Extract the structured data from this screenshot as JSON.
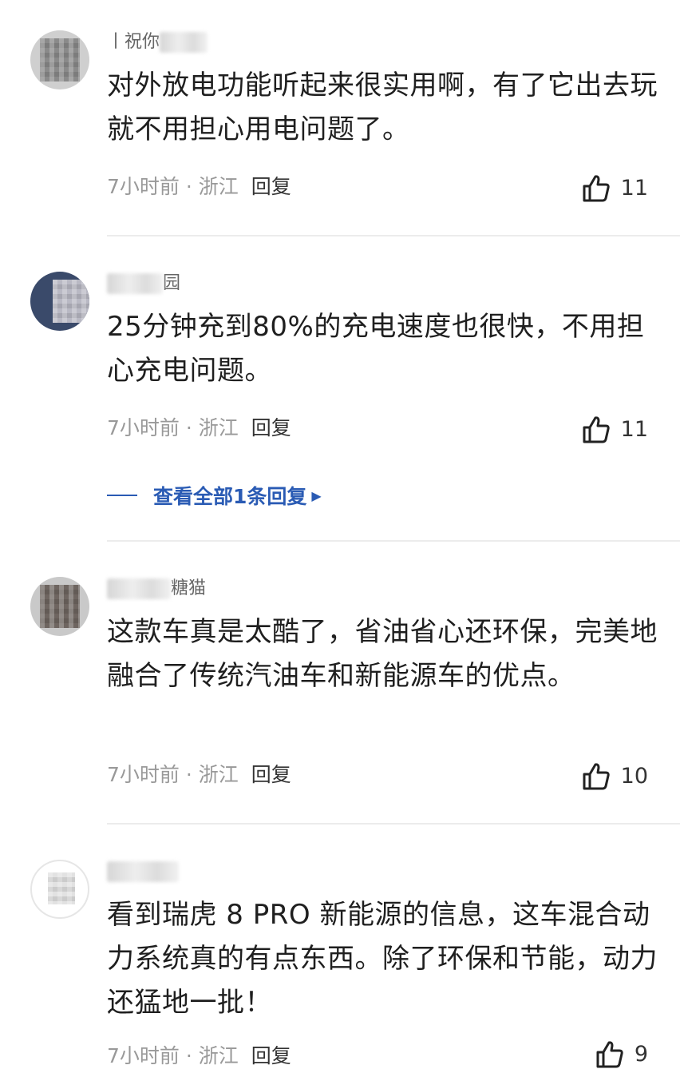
{
  "comments": [
    {
      "username": "丨祝你",
      "text": "对外放电功能听起来很实用啊，有了它出去玩就不用担心用电问题了。",
      "time": "7小时前 · 浙江",
      "reply": "回复",
      "likes": "11"
    },
    {
      "username": "园",
      "text": "25分钟充到80%的充电速度也很快，不用担心充电问题。",
      "time": "7小时前 · 浙江",
      "reply": "回复",
      "likes": "11",
      "view_all_replies": "查看全部1条回复"
    },
    {
      "username": "糖猫",
      "text": "这款车真是太酷了，省油省心还环保，完美地融合了传统汽油车和新能源车的优点。",
      "time": "7小时前 · 浙江",
      "reply": "回复",
      "likes": "10"
    },
    {
      "username": "",
      "text": "看到瑞虎 8 PRO 新能源的信息，这车混合动力系统真的有点东西。除了环保和节能，动力还猛地一批！",
      "time": "7小时前 · 浙江",
      "reply": "回复",
      "likes": "9"
    }
  ],
  "icons": {
    "like": "thumbs-up-icon"
  },
  "colors": {
    "link": "#2a5bb4",
    "meta": "#999999",
    "text": "#1f1f1f",
    "divider": "#ececec"
  }
}
